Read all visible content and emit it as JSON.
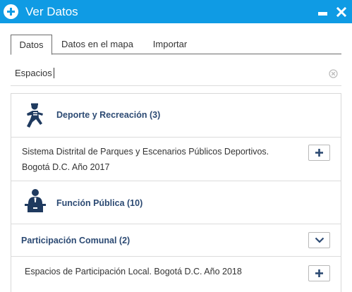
{
  "window": {
    "title": "Ver Datos",
    "accent_color": "#0f9be4",
    "icons": {
      "add": "plus-circle-icon",
      "minimize": "minimize-icon",
      "close": "close-icon"
    }
  },
  "tabs": [
    {
      "label": "Datos",
      "active": true
    },
    {
      "label": "Datos en el mapa",
      "active": false
    },
    {
      "label": "Importar",
      "active": false
    }
  ],
  "search": {
    "value": "Espacios",
    "clear_icon": "clear-icon"
  },
  "categories": [
    {
      "label": "Deporte y Recreación (3)",
      "icon": "runner-icon"
    },
    {
      "label": "Función Pública (10)",
      "icon": "speaker-podium-icon"
    }
  ],
  "items": [
    {
      "title_line1": "Sistema Distrital de Parques y Escenarios Públicos Deportivos.",
      "title_line2": "Bogotá D.C. Año 2017",
      "action": "+"
    },
    {
      "title_line1": "Espacios de Participación Local. Bogotá D.C. Año 2018",
      "action": "+"
    }
  ],
  "subcategory": {
    "label": "Participación Comunal (2)",
    "toggle_icon": "chevron-down-icon"
  },
  "colors": {
    "category_text": "#2c4a73",
    "border": "#dcdcdc"
  }
}
